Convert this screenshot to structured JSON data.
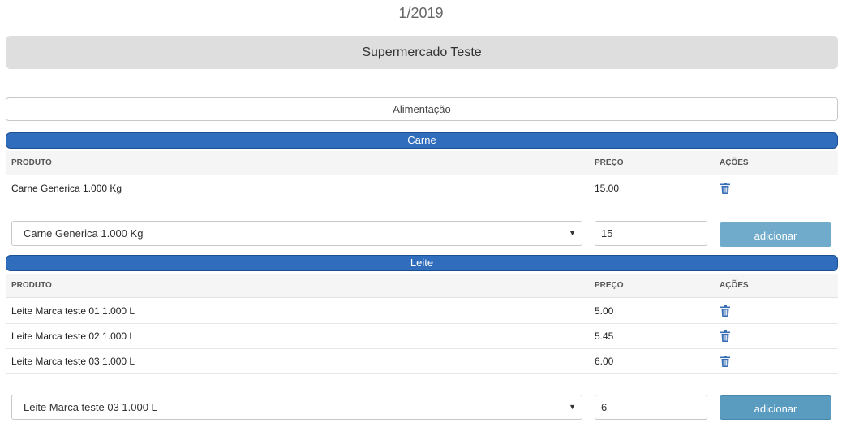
{
  "header": {
    "period": "1/2019",
    "store_name": "Supermercado Teste",
    "group_name": "Alimentação"
  },
  "columns": {
    "product": "PRODUTO",
    "price": "PREÇO",
    "actions": "AÇÕES"
  },
  "sections": [
    {
      "title": "Carne",
      "rows": [
        {
          "product": "Carne Generica 1.000 Kg",
          "price": "15.00"
        }
      ],
      "add_form": {
        "selected_product": "Carne Generica 1.000 Kg",
        "price_value": "15",
        "button_label": "adicionar"
      }
    },
    {
      "title": "Leite",
      "rows": [
        {
          "product": "Leite Marca teste 01 1.000 L",
          "price": "5.00"
        },
        {
          "product": "Leite Marca teste 02 1.000 L",
          "price": "5.45"
        },
        {
          "product": "Leite Marca teste 03 1.000 L",
          "price": "6.00"
        }
      ],
      "add_form": {
        "selected_product": "Leite Marca teste 03 1.000 L",
        "price_value": "6",
        "button_label": "adicionar"
      }
    }
  ],
  "colors": {
    "category_bar": "#306ebd",
    "button": "#71abcc",
    "button_active": "#5a9cc0",
    "trash_icon": "#3a6fb5"
  },
  "icons": {
    "row_action": "trash-icon",
    "select": "chevron-down-icon"
  }
}
